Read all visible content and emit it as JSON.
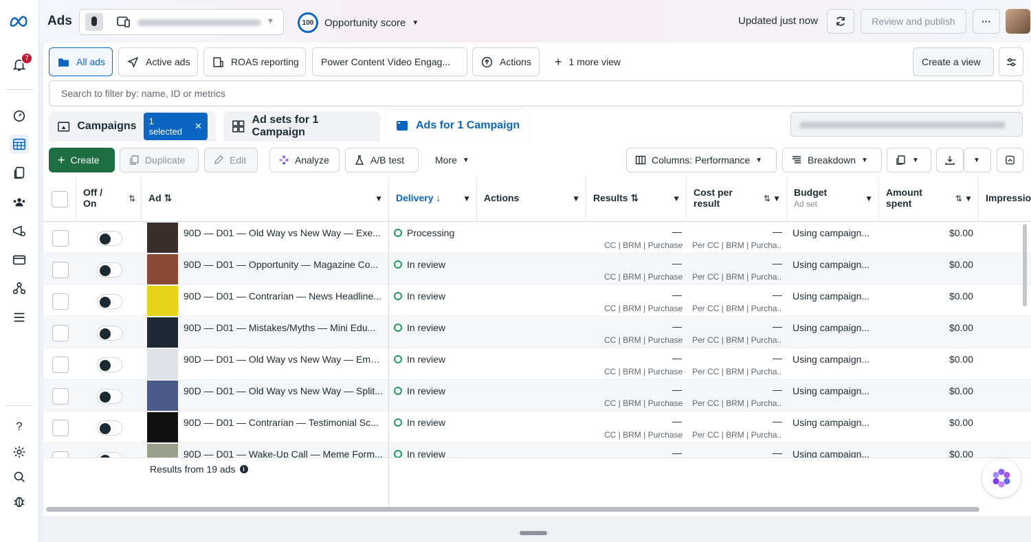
{
  "header": {
    "title": "Ads",
    "opportunity_score": "100",
    "opportunity_label": "Opportunity score",
    "updated": "Updated just now",
    "review_publish": "Review and publish",
    "more": "···"
  },
  "sidebar": {
    "notifications_count": "7",
    "help": "?"
  },
  "views": {
    "all_ads": "All ads",
    "active_ads": "Active ads",
    "roas": "ROAS reporting",
    "power": "Power Content Video Engag...",
    "actions": "Actions",
    "more_view": "1 more view",
    "create_view": "Create a view"
  },
  "search": {
    "placeholder": "Search to filter by: name, ID or metrics"
  },
  "tabs": {
    "campaigns": "Campaigns",
    "selected": "1 selected",
    "adsets": "Ad sets for 1 Campaign",
    "ads": "Ads for 1 Campaign"
  },
  "toolbar": {
    "create": "Create",
    "duplicate": "Duplicate",
    "edit": "Edit",
    "analyze": "Analyze",
    "abtest": "A/B test",
    "more": "More",
    "columns": "Columns: Performance",
    "breakdown": "Breakdown"
  },
  "columns": {
    "offon": "Off / On",
    "ad": "Ad",
    "delivery": "Delivery",
    "actions": "Actions",
    "results": "Results",
    "cpr": "Cost per result",
    "budget": "Budget",
    "budget_sub": "Ad set",
    "amount": "Amount spent",
    "impressions": "Impressio"
  },
  "rows": [
    {
      "name": "90D — D01 — Old Way vs New Way — Exe...",
      "status": "Processing",
      "results": "—",
      "results_sub": "CC | BRM | Purchase",
      "cpr": "—",
      "cpr_sub": "Per CC | BRM | Purcha...",
      "budget": "Using campaign...",
      "amount": "$0.00",
      "thumb": "#3a2f2a"
    },
    {
      "name": "90D — D01 — Opportunity — Magazine Co...",
      "status": "In review",
      "results": "—",
      "results_sub": "CC | BRM | Purchase",
      "cpr": "—",
      "cpr_sub": "Per CC | BRM | Purcha...",
      "budget": "Using campaign...",
      "amount": "$0.00",
      "thumb": "#8a4b36"
    },
    {
      "name": "90D — D01 — Contrarian — News Headline...",
      "status": "In review",
      "results": "—",
      "results_sub": "CC | BRM | Purchase",
      "cpr": "—",
      "cpr_sub": "Per CC | BRM | Purcha...",
      "budget": "Using campaign...",
      "amount": "$0.00",
      "thumb": "#e6d51c"
    },
    {
      "name": "90D — D01 — Mistakes/Myths — Mini Edu...",
      "status": "In review",
      "results": "—",
      "results_sub": "CC | BRM | Purchase",
      "cpr": "—",
      "cpr_sub": "Per CC | BRM | Purcha...",
      "budget": "Using campaign...",
      "amount": "$0.00",
      "thumb": "#1f2933"
    },
    {
      "name": "90D — D01 — Old Way vs New Way — Ema...",
      "status": "In review",
      "results": "—",
      "results_sub": "CC | BRM | Purchase",
      "cpr": "—",
      "cpr_sub": "Per CC | BRM | Purcha...",
      "budget": "Using campaign...",
      "amount": "$0.00",
      "thumb": "#dfe3e8"
    },
    {
      "name": "90D — D01 — Old Way vs New Way — Split...",
      "status": "In review",
      "results": "—",
      "results_sub": "CC | BRM | Purchase",
      "cpr": "—",
      "cpr_sub": "Per CC | BRM | Purcha...",
      "budget": "Using campaign...",
      "amount": "$0.00",
      "thumb": "#4b5a8a"
    },
    {
      "name": "90D — D01 — Contrarian — Testimonial Sc...",
      "status": "In review",
      "results": "—",
      "results_sub": "CC | BRM | Purchase",
      "cpr": "—",
      "cpr_sub": "Per CC | BRM | Purcha...",
      "budget": "Using campaign...",
      "amount": "$0.00",
      "thumb": "#111111"
    },
    {
      "name": "90D — D01 — Wake-Up Call — Meme Form...",
      "status": "In review",
      "results": "—",
      "results_sub": "",
      "cpr": "—",
      "cpr_sub": "",
      "budget": "Using campaign...",
      "amount": "$0.00",
      "thumb": "#9aa08a"
    }
  ],
  "footer": {
    "results_from": "Results from 19 ads"
  }
}
